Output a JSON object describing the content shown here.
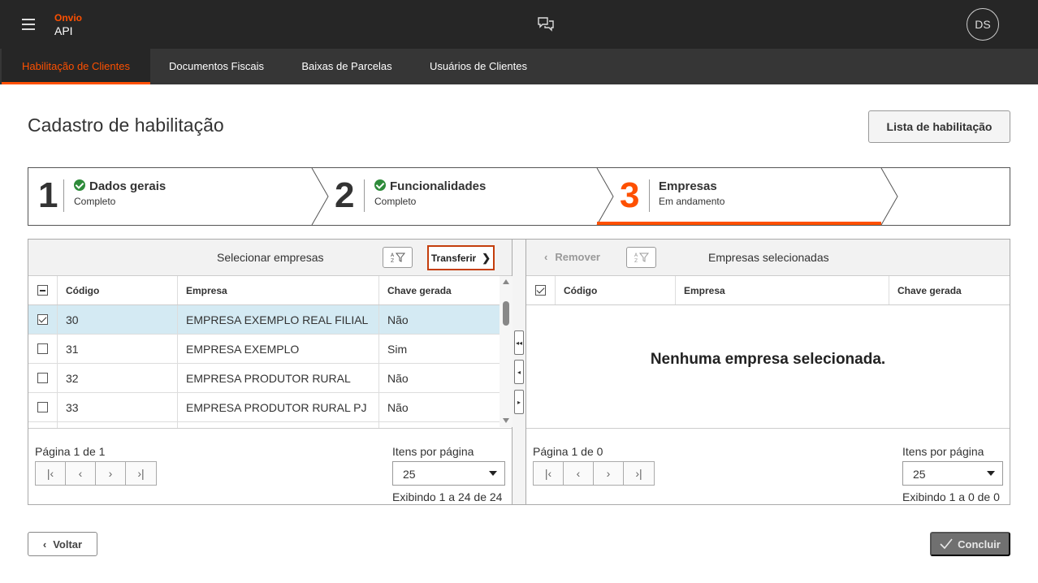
{
  "header": {
    "brand_name": "Onvio",
    "product": "API",
    "avatar_initials": "DS",
    "icons": {
      "menu": "hamburger-icon",
      "chat": "chat-bubbles-icon"
    }
  },
  "nav": {
    "tabs": [
      {
        "label": "Habilitação de Clientes",
        "active": true
      },
      {
        "label": "Documentos Fiscais",
        "active": false
      },
      {
        "label": "Baixas de Parcelas",
        "active": false
      },
      {
        "label": "Usuários de Clientes",
        "active": false
      }
    ]
  },
  "page": {
    "title": "Cadastro de habilitação",
    "list_button": "Lista de habilitação"
  },
  "stepper": {
    "steps": [
      {
        "number": "1",
        "title": "Dados gerais",
        "status": "Completo",
        "complete": true
      },
      {
        "number": "2",
        "title": "Funcionalidades",
        "status": "Completo",
        "complete": true
      },
      {
        "number": "3",
        "title": "Empresas",
        "status": "Em andamento",
        "complete": false
      }
    ]
  },
  "left_panel": {
    "title": "Selecionar empresas",
    "transfer_label": "Transferir",
    "columns": [
      "Código",
      "Empresa",
      "Chave gerada"
    ],
    "rows": [
      {
        "code": "30",
        "company": "EMPRESA EXEMPLO REAL FILIAL",
        "key": "Não",
        "checked": true
      },
      {
        "code": "31",
        "company": "EMPRESA EXEMPLO",
        "key": "Sim",
        "checked": false
      },
      {
        "code": "32",
        "company": "EMPRESA PRODUTOR RURAL",
        "key": "Não",
        "checked": false
      },
      {
        "code": "33",
        "company": "EMPRESA PRODUTOR RURAL PJ",
        "key": "Não",
        "checked": false
      }
    ],
    "page_label": "Página 1 de 1",
    "items_per_page_label": "Itens por página",
    "items_per_page": "25",
    "showing": "Exibindo 1 a 24 de 24"
  },
  "right_panel": {
    "title": "Empresas selecionadas",
    "remove_label": "Remover",
    "columns": [
      "Código",
      "Empresa",
      "Chave gerada"
    ],
    "empty_message": "Nenhuma empresa selecionada.",
    "page_label": "Página 1 de 0",
    "items_per_page_label": "Itens por página",
    "items_per_page": "25",
    "showing": "Exibindo 1 a 0 de 0"
  },
  "footer": {
    "back_label": "Voltar",
    "finish_label": "Concluir"
  },
  "colors": {
    "accent": "#fe5000",
    "header_bg": "#262626",
    "nav_bg": "#363636",
    "selected_row": "#d4eaf3",
    "check_green": "#2e8b3a"
  }
}
